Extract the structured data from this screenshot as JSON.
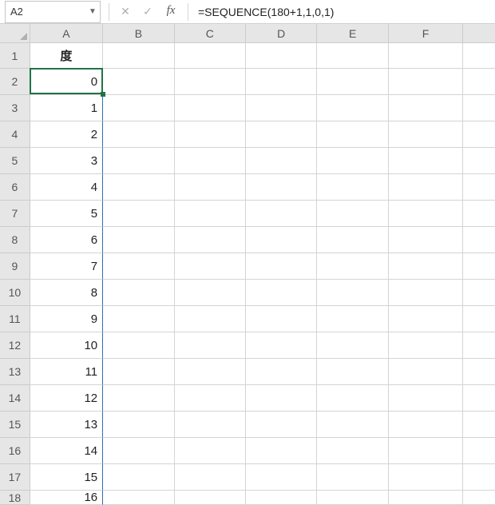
{
  "name_box": {
    "value": "A2"
  },
  "formula_bar": {
    "value": "=SEQUENCE(180+1,1,0,1)",
    "fx_label": "fx"
  },
  "columns": [
    "A",
    "B",
    "C",
    "D",
    "E",
    "F"
  ],
  "rows": [
    {
      "n": 1,
      "A": "度"
    },
    {
      "n": 2,
      "A": "0"
    },
    {
      "n": 3,
      "A": "1"
    },
    {
      "n": 4,
      "A": "2"
    },
    {
      "n": 5,
      "A": "3"
    },
    {
      "n": 6,
      "A": "4"
    },
    {
      "n": 7,
      "A": "5"
    },
    {
      "n": 8,
      "A": "6"
    },
    {
      "n": 9,
      "A": "7"
    },
    {
      "n": 10,
      "A": "8"
    },
    {
      "n": 11,
      "A": "9"
    },
    {
      "n": 12,
      "A": "10"
    },
    {
      "n": 13,
      "A": "11"
    },
    {
      "n": 14,
      "A": "12"
    },
    {
      "n": 15,
      "A": "13"
    },
    {
      "n": 16,
      "A": "14"
    },
    {
      "n": 17,
      "A": "15"
    },
    {
      "n": 18,
      "A": "16"
    }
  ],
  "active_cell": "A2"
}
